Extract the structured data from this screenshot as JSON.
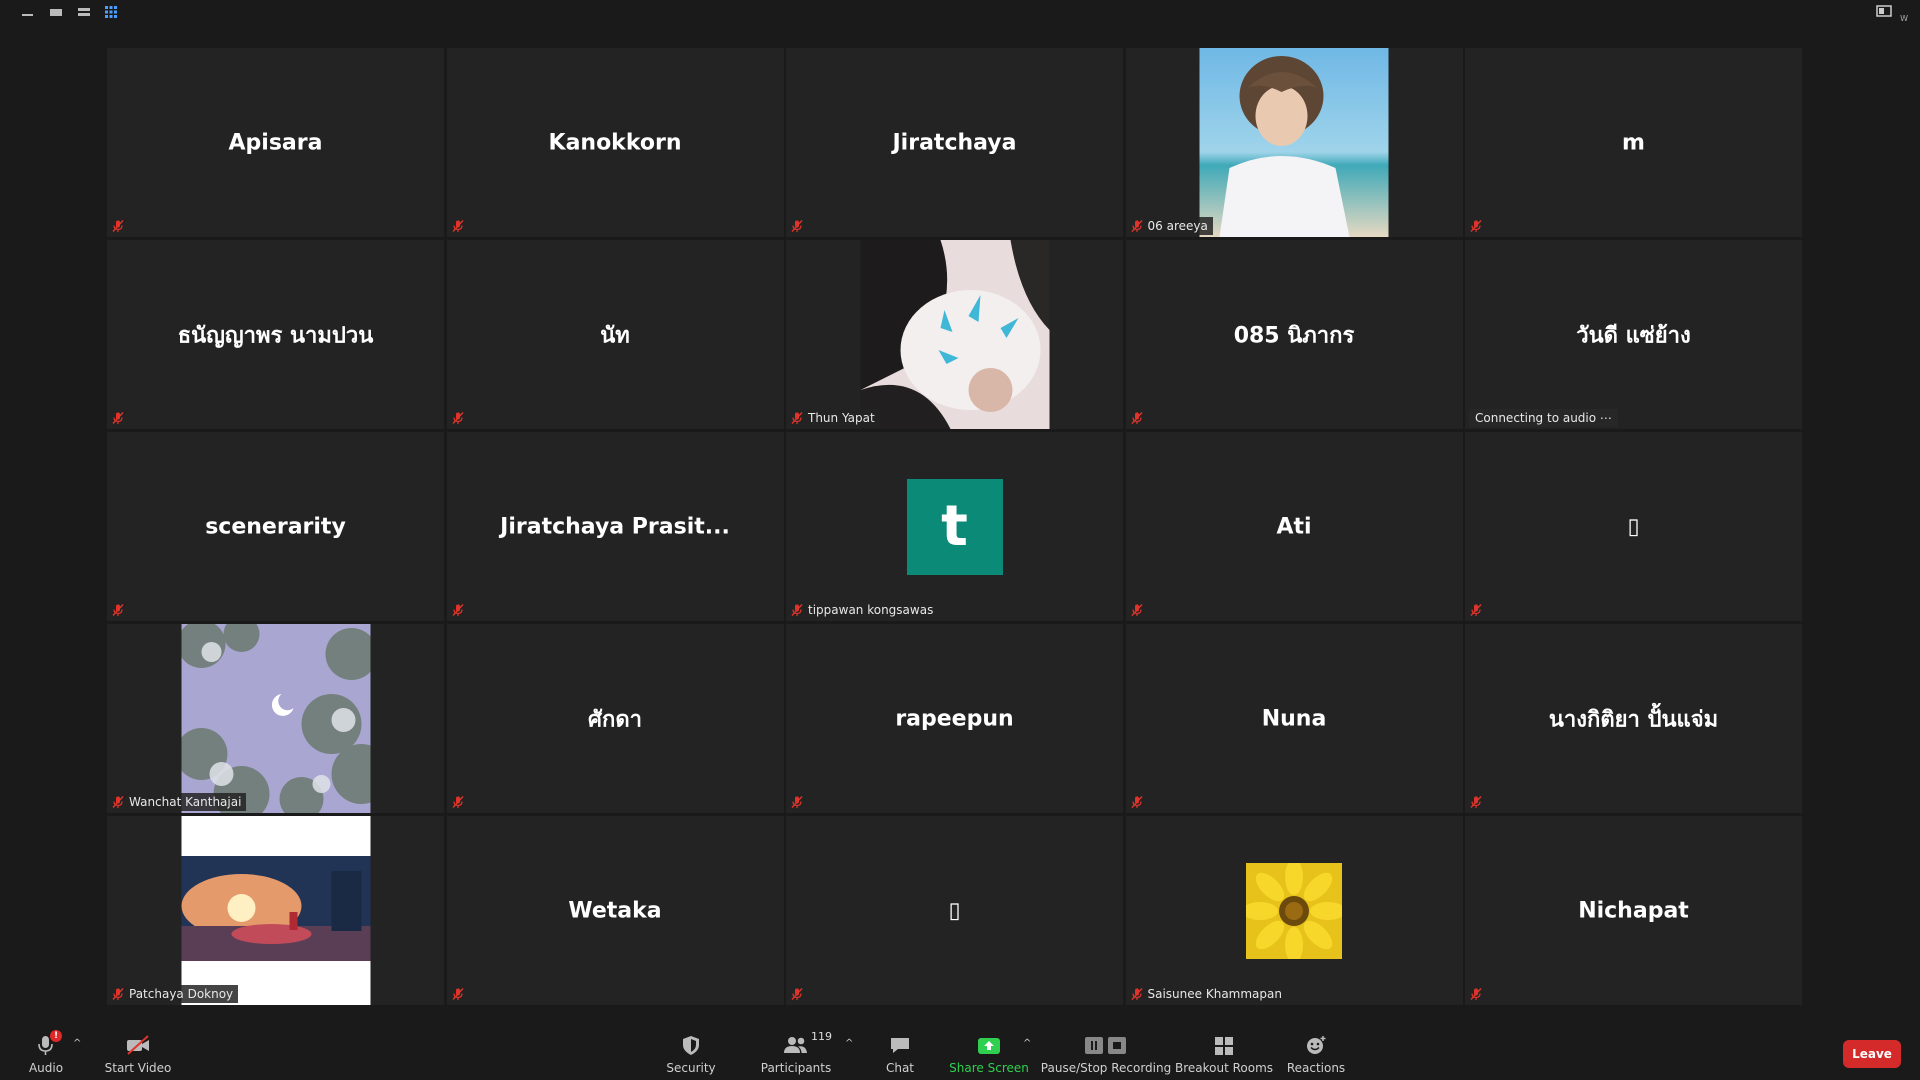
{
  "top_bar": {
    "view_icons": [
      "minimize-icon",
      "single-view-icon",
      "split-view-icon",
      "grid-view-icon"
    ],
    "active_view": "grid-view-icon",
    "corner_icon": "side-by-side-icon",
    "corner_text": "W"
  },
  "gallery": {
    "tiles": [
      {
        "name": "Apisara",
        "type": "name"
      },
      {
        "name": "Kanokkorn",
        "type": "name"
      },
      {
        "name": "Jiratchaya",
        "type": "name"
      },
      {
        "name": "06 areeya",
        "type": "photo",
        "image": "person-on-beach"
      },
      {
        "name": "m",
        "type": "name"
      },
      {
        "name": "ธนัญญาพร นามปวน",
        "type": "name"
      },
      {
        "name": "นัท",
        "type": "name"
      },
      {
        "name": "Thun Yapat",
        "type": "photo",
        "image": "cat-with-claws"
      },
      {
        "name": "085 นิภากร",
        "type": "name"
      },
      {
        "name": "วันดี แซ่ย้าง",
        "type": "name",
        "status": "Connecting to audio ⋯"
      },
      {
        "name": "scenerarity",
        "type": "name"
      },
      {
        "name": "Jiratchaya Prasit...",
        "type": "name"
      },
      {
        "name": "tippawan kongsawas",
        "type": "avatar",
        "initial": "t"
      },
      {
        "name": "Ati",
        "type": "name"
      },
      {
        "name": "▯",
        "type": "name"
      },
      {
        "name": "Wanchat Kanthajai",
        "type": "photo",
        "image": "moon-and-blossoms"
      },
      {
        "name": "ศักดา",
        "type": "name"
      },
      {
        "name": "rapeepun",
        "type": "name"
      },
      {
        "name": "Nuna",
        "type": "name"
      },
      {
        "name": "นางกิติยา ปั้นแจ่ม",
        "type": "name"
      },
      {
        "name": "Patchaya Doknoy",
        "type": "photo",
        "image": "sunset-room"
      },
      {
        "name": "Wetaka",
        "type": "name"
      },
      {
        "name": "▯",
        "type": "name"
      },
      {
        "name": "Saisunee Khammapan",
        "type": "flower",
        "image": "sunflower"
      },
      {
        "name": "Nichapat",
        "type": "name"
      }
    ]
  },
  "toolbar": {
    "audio": {
      "label": "Audio",
      "badge": "!"
    },
    "video": {
      "label": "Start Video"
    },
    "security": {
      "label": "Security"
    },
    "participants": {
      "label": "Participants",
      "count": "119"
    },
    "chat": {
      "label": "Chat"
    },
    "share": {
      "label": "Share Screen"
    },
    "recording": {
      "label": "Pause/Stop Recording"
    },
    "breakout": {
      "label": "Breakout Rooms"
    },
    "reactions": {
      "label": "Reactions"
    },
    "leave": {
      "label": "Leave"
    }
  },
  "colors": {
    "background": "#1a1a1a",
    "tile": "#232323",
    "muted_red": "#e0342a",
    "avatar_teal": "#0a8a77",
    "share_green": "#2fd04f",
    "leave_red": "#d42a2a"
  }
}
